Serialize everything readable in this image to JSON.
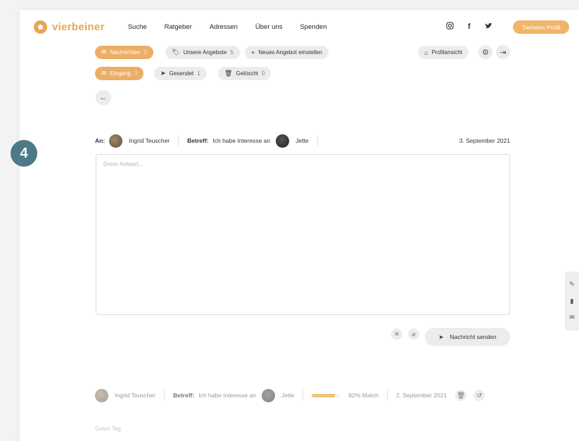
{
  "step": "4",
  "brand": {
    "name": "vierbeiner",
    "accent": "#e8a553"
  },
  "nav": [
    "Suche",
    "Ratgeber",
    "Adressen",
    "Über uns",
    "Spenden"
  ],
  "social": [
    "instagram-icon",
    "facebook-icon",
    "twitter-icon"
  ],
  "header_button": "Tierheim Profil",
  "toolbar": {
    "tabs": [
      {
        "label": "Nachrichten",
        "count": "3",
        "icon": "mail-icon"
      },
      {
        "label": "Unsere Angebote",
        "count": "5",
        "icon": "tag-icon"
      },
      {
        "label": "Neues Angebot einstellen",
        "icon": "plus-icon"
      }
    ],
    "profile_view": "Profilansicht"
  },
  "folders": [
    {
      "label": "Eingang",
      "count": "3",
      "icon": "inbox-icon"
    },
    {
      "label": "Gesendet",
      "count": "1",
      "icon": "send-icon"
    },
    {
      "label": "Gelöscht",
      "count": "0",
      "icon": "trash-icon"
    }
  ],
  "compose": {
    "to_label": "An:",
    "recipient": "Ingrid Teuscher",
    "subject_label": "Betreff:",
    "subject": "Ich habe Interesse an",
    "animal": "Jette",
    "date": "3. September 2021",
    "placeholder": "Deine Antwort...",
    "send_label": "Nachricht senden"
  },
  "history": {
    "sender": "Ingrid Teuscher",
    "subject_label": "Betreff:",
    "subject": "Ich habe Interesse an",
    "animal": "Jette",
    "match_fraction": 0.82,
    "match_label": "82% Match",
    "date": "2. September 2021",
    "preview": "Guten Tag"
  }
}
